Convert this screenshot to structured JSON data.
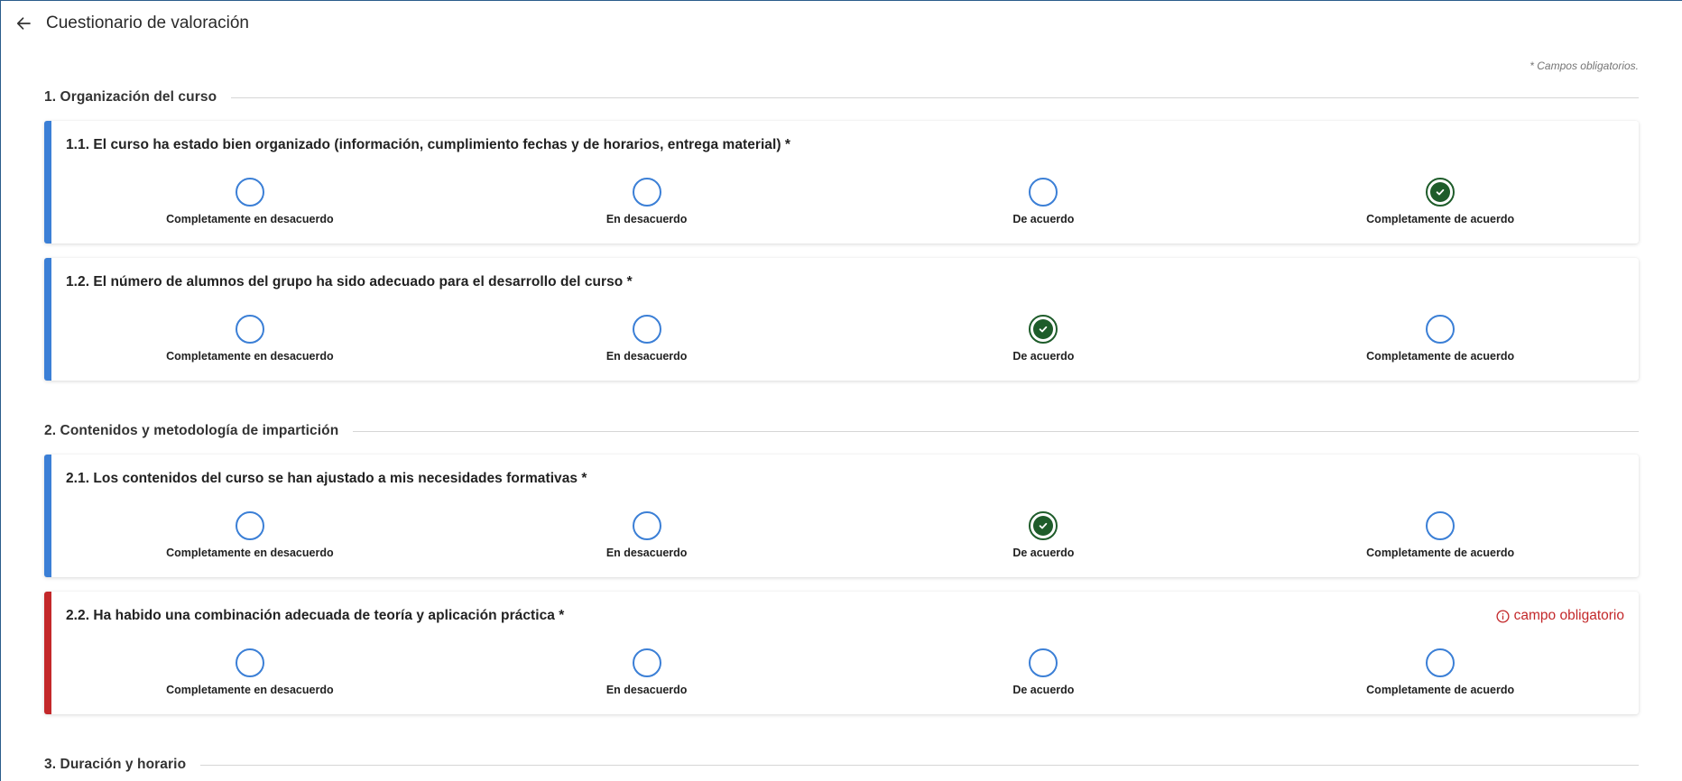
{
  "header": {
    "back_icon": "arrow-left-icon",
    "title": "Cuestionario de valoración"
  },
  "required_note": "* Campos obligatorios.",
  "options": [
    "Completamente en desacuerdo",
    "En desacuerdo",
    "De acuerdo",
    "Completamente de acuerdo"
  ],
  "sections": [
    {
      "title": "1. Organización del curso",
      "questions": [
        {
          "text": "1.1. El curso ha estado bien organizado (información, cumplimiento fechas y de horarios, entrega material) *",
          "selected": 3,
          "error": ""
        },
        {
          "text": "1.2. El número de alumnos del grupo ha sido adecuado para el desarrollo del curso *",
          "selected": 2,
          "error": ""
        }
      ]
    },
    {
      "title": "2. Contenidos y metodología de impartición",
      "questions": [
        {
          "text": "2.1. Los contenidos del curso se han ajustado a mis necesidades formativas *",
          "selected": 2,
          "error": ""
        },
        {
          "text": "2.2. Ha habido una combinación adecuada de teoría y aplicación práctica *",
          "selected": -1,
          "error": "campo obligatorio"
        }
      ]
    },
    {
      "title": "3. Duración y horario",
      "questions": []
    }
  ],
  "colors": {
    "accent": "#3b7fd6",
    "error": "#c3282a",
    "checked": "#1e5c2a"
  }
}
